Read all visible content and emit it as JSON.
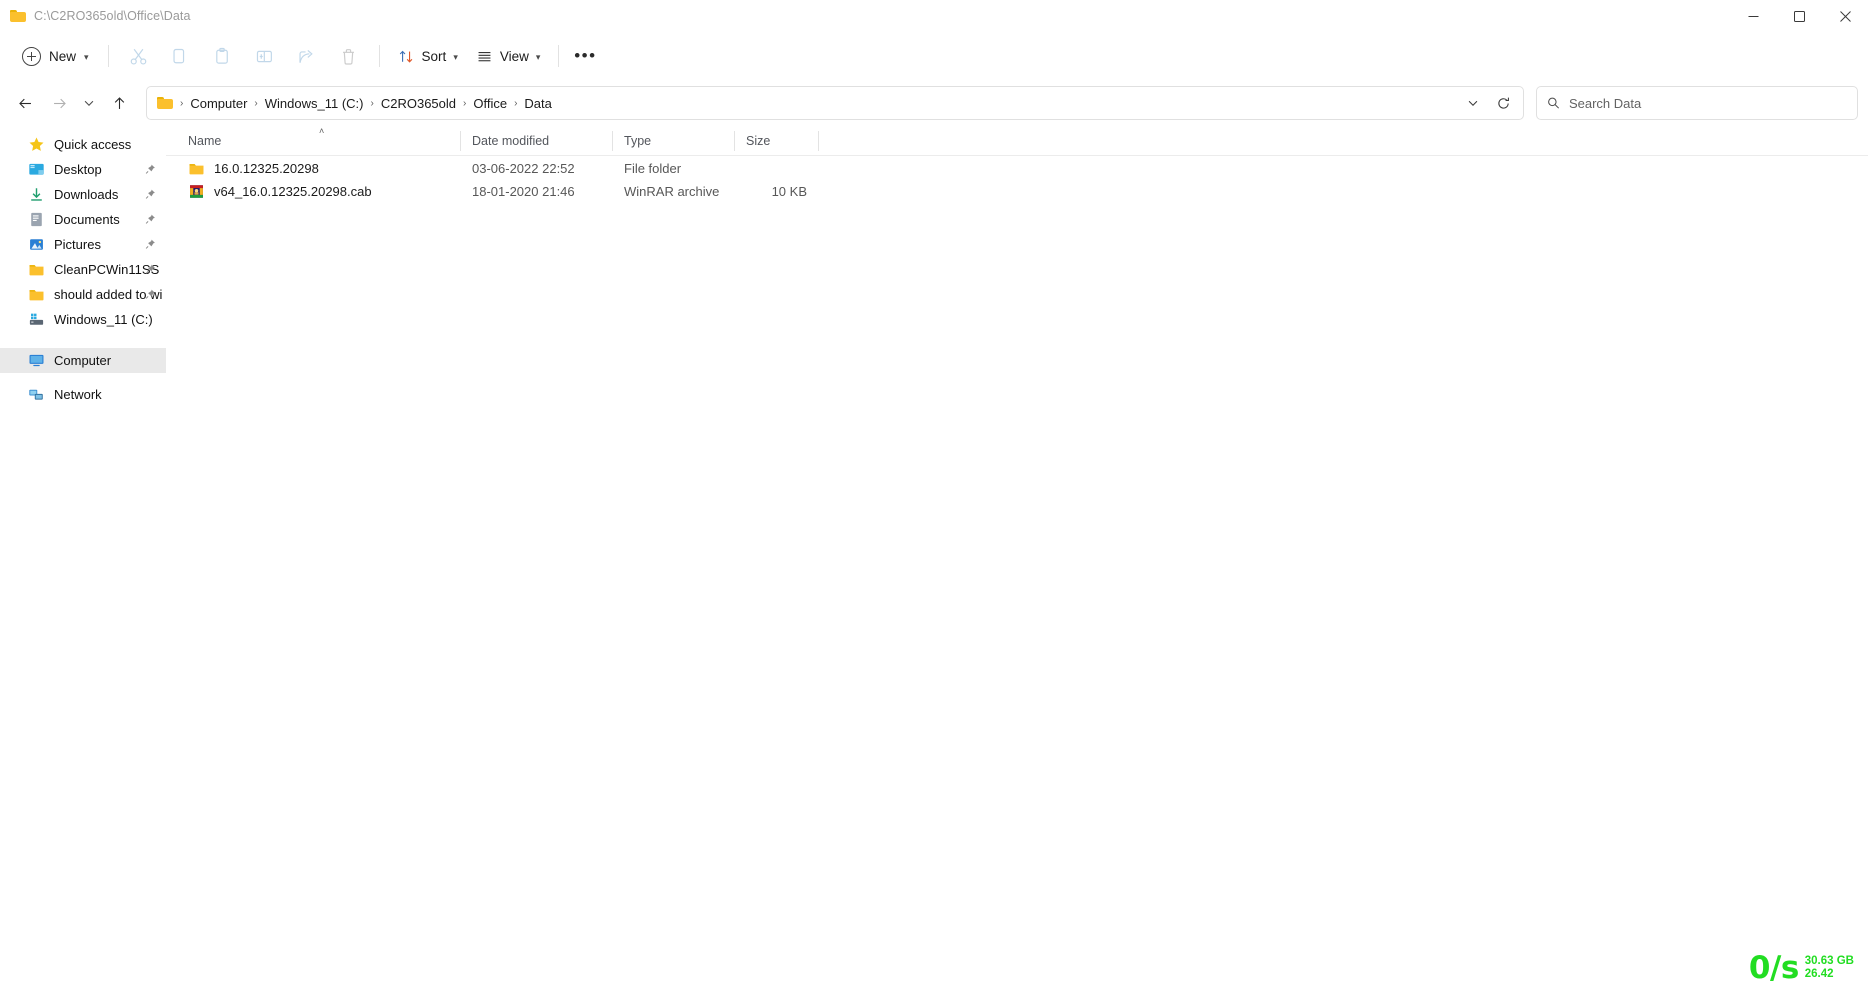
{
  "window": {
    "title": "C:\\C2RO365old\\Office\\Data",
    "folder_icon": "folder-icon",
    "controls": {
      "minimize": "minimize-icon",
      "maximize": "maximize-icon",
      "close": "close-icon"
    }
  },
  "toolbar": {
    "new_label": "New",
    "new_chevron": "chevron-down-icon",
    "cut_label": "Cut",
    "copy_label": "Copy",
    "paste_label": "Paste",
    "rename_label": "Rename",
    "share_label": "Share",
    "delete_label": "Delete",
    "sort_label": "Sort",
    "sort_chevron": "chevron-down-icon",
    "view_label": "View",
    "view_chevron": "chevron-down-icon",
    "more_label": "•••"
  },
  "navigation": {
    "back": "back-arrow-icon",
    "forward": "forward-arrow-icon",
    "recent": "chevron-down-icon",
    "up": "up-arrow-icon",
    "address_dropdown": "chevron-down-icon",
    "refresh": "refresh-icon"
  },
  "breadcrumb": {
    "icon": "folder-icon",
    "separator": "›",
    "items": [
      {
        "label": "Computer"
      },
      {
        "label": "Windows_11 (C:)"
      },
      {
        "label": "C2RO365old"
      },
      {
        "label": "Office"
      },
      {
        "label": "Data"
      }
    ]
  },
  "search": {
    "icon": "search-icon",
    "placeholder": "Search Data",
    "value": ""
  },
  "sidebar": {
    "groups": [
      {
        "items": [
          {
            "label": "Quick access",
            "icon": "star-icon",
            "pinned": false,
            "selected": false,
            "indent": false
          }
        ]
      },
      {
        "items": [
          {
            "label": "Desktop",
            "icon": "desktop-icon",
            "pinned": true,
            "selected": false,
            "indent": true
          },
          {
            "label": "Downloads",
            "icon": "downloads-icon",
            "pinned": true,
            "selected": false,
            "indent": true
          },
          {
            "label": "Documents",
            "icon": "documents-icon",
            "pinned": true,
            "selected": false,
            "indent": true
          },
          {
            "label": "Pictures",
            "icon": "pictures-icon",
            "pinned": true,
            "selected": false,
            "indent": true
          },
          {
            "label": "CleanPCWin11SS",
            "icon": "folder-icon",
            "pinned": true,
            "selected": false,
            "indent": true
          },
          {
            "label": "should added to wi",
            "icon": "folder-icon",
            "pinned": true,
            "selected": false,
            "indent": true
          },
          {
            "label": "Windows_11 (C:)",
            "icon": "drive-icon",
            "pinned": false,
            "selected": false,
            "indent": true
          }
        ]
      },
      {
        "items": [
          {
            "label": "Computer",
            "icon": "computer-icon",
            "pinned": false,
            "selected": true,
            "indent": false
          }
        ]
      },
      {
        "items": [
          {
            "label": "Network",
            "icon": "network-icon",
            "pinned": false,
            "selected": false,
            "indent": false
          }
        ]
      }
    ]
  },
  "filelist": {
    "columns": {
      "name": "Name",
      "date_modified": "Date modified",
      "type": "Type",
      "size": "Size"
    },
    "sort_column": "Name",
    "sort_direction": "ascending",
    "sort_caret": "˄",
    "rows": [
      {
        "name": "16.0.12325.20298",
        "date_modified": "03-06-2022 22:52",
        "type": "File folder",
        "size": "",
        "icon": "folder-icon"
      },
      {
        "name": "v64_16.0.12325.20298.cab",
        "date_modified": "18-01-2020 21:46",
        "type": "WinRAR archive",
        "size": "10 KB",
        "icon": "winrar-archive-icon"
      }
    ]
  },
  "netspeed": {
    "rate": "0/s",
    "total": "30.63 GB",
    "secondary": "26.42",
    "color": "#22dd22"
  }
}
